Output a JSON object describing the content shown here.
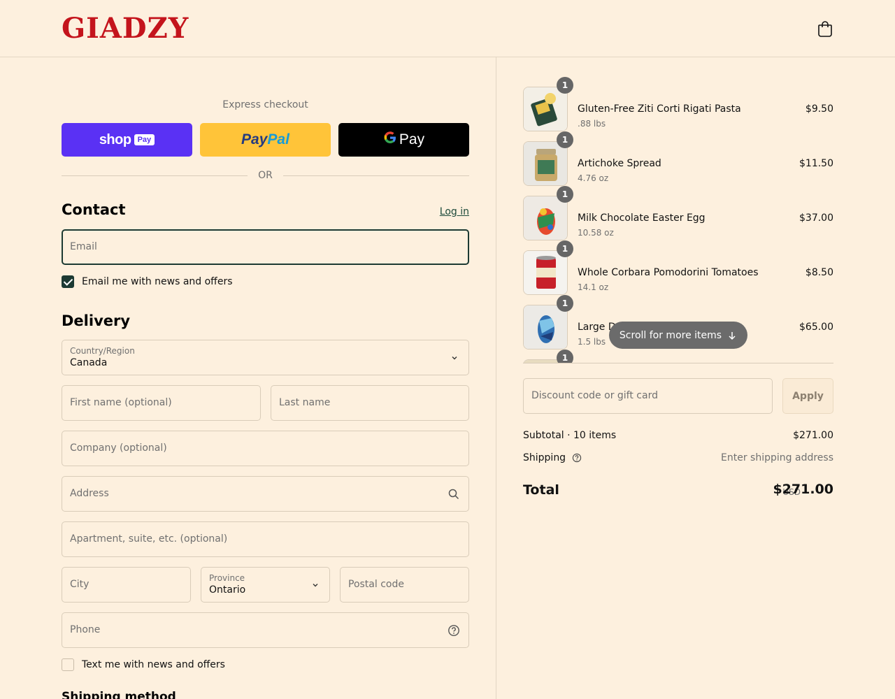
{
  "header": {
    "logo_text": "GIADZY",
    "cart_icon": "shopping-bag-icon",
    "brand_color": "#c4141c"
  },
  "express": {
    "title": "Express checkout",
    "shop_pay_word": "shop",
    "shop_pay_pill": "Pay",
    "paypal_pay": "Pay",
    "paypal_pal": "Pal",
    "gpay_g": "G",
    "gpay_word": "Pay",
    "or_text": "OR"
  },
  "contact": {
    "title": "Contact",
    "login_label": "Log in",
    "email_placeholder": "Email",
    "news_label": "Email me with news and offers",
    "news_checked": true
  },
  "delivery": {
    "title": "Delivery",
    "country_label": "Country/Region",
    "country_value": "Canada",
    "first_name_placeholder": "First name (optional)",
    "last_name_placeholder": "Last name",
    "company_placeholder": "Company (optional)",
    "address_placeholder": "Address",
    "apartment_placeholder": "Apartment, suite, etc. (optional)",
    "city_placeholder": "City",
    "province_label": "Province",
    "province_value": "Ontario",
    "postal_placeholder": "Postal code",
    "phone_placeholder": "Phone",
    "sms_label": "Text me with news and offers",
    "sms_checked": false
  },
  "shipping_method": {
    "title": "Shipping method"
  },
  "cart": {
    "items": [
      {
        "name": "Gluten-Free Ziti Corti Rigati Pasta",
        "variant": ".88 lbs",
        "price": "$9.50",
        "qty": "1"
      },
      {
        "name": "Artichoke Spread",
        "variant": "4.76 oz",
        "price": "$11.50",
        "qty": "1"
      },
      {
        "name": "Milk Chocolate Easter Egg",
        "variant": "10.58 oz",
        "price": "$37.00",
        "qty": "1"
      },
      {
        "name": "Whole Corbara Pomodorini Tomatoes",
        "variant": "14.1 oz",
        "price": "$8.50",
        "qty": "1"
      },
      {
        "name": "Large Dark Chocolate Easter Egg",
        "variant": "1.5 lbs",
        "price": "$65.00",
        "qty": "1"
      },
      {
        "name": "",
        "variant": "",
        "price": "",
        "qty": "1"
      }
    ],
    "scroll_hint": "Scroll for more items"
  },
  "summary": {
    "discount_placeholder": "Discount code or gift card",
    "apply_label": "Apply",
    "subtotal_label": "Subtotal · 10 items",
    "subtotal_value": "$271.00",
    "shipping_label": "Shipping",
    "shipping_value": "Enter shipping address",
    "total_label": "Total",
    "currency": "USD",
    "total_value": "$271.00"
  }
}
